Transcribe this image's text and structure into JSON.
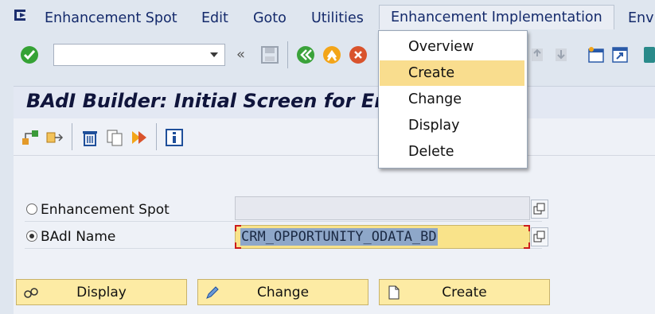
{
  "menubar": {
    "items": [
      "Enhancement Spot",
      "Edit",
      "Goto",
      "Utilities",
      "Enhancement Implementation",
      "Envi"
    ],
    "active_index": 4
  },
  "toolbar": {
    "command_field": {
      "value": "",
      "placeholder": ""
    }
  },
  "dropdown": {
    "items": [
      "Overview",
      "Create",
      "Change",
      "Display",
      "Delete"
    ],
    "highlighted_index": 1
  },
  "screen": {
    "title": "BAdI Builder: Initial Screen for Enhancements"
  },
  "form": {
    "option1_label": "Enhancement Spot",
    "option2_label": "BAdI Name",
    "field1_value": "",
    "field2_value": "CRM_OPPORTUNITY_ODATA_BD",
    "selected_option": "BAdI Name"
  },
  "buttons": {
    "display_label": "Display",
    "change_label": "Change",
    "create_label": "Create"
  },
  "colors": {
    "menu_text": "#142a6b",
    "highlight": "#f9dd8e",
    "button_bg": "#fdeba4",
    "input_active": "#f9e38a",
    "selection": "#8ea7c9",
    "background": "#dfe6ef"
  }
}
